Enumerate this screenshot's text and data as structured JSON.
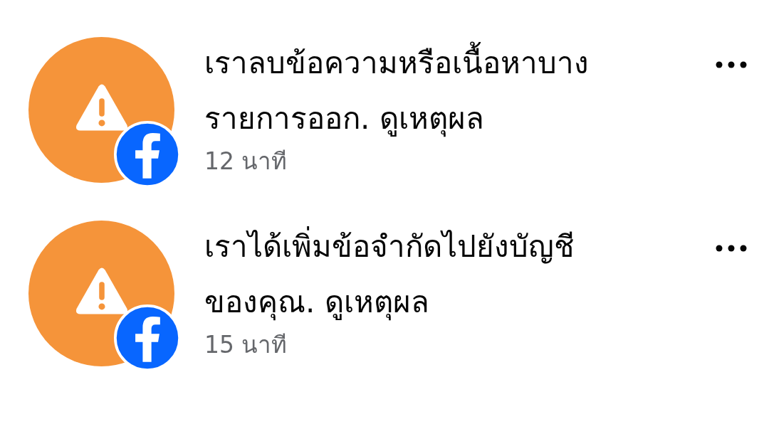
{
  "notifications": [
    {
      "message_lines": [
        "เราลบข้อความหรือเนื้อหาบาง",
        "รายการออก. ดูเหตุผล"
      ],
      "time": "12 นาที"
    },
    {
      "message_lines": [
        "เราได้เพิ่มข้อจำกัดไปยังบัญชี",
        "ของคุณ. ดูเหตุผล"
      ],
      "time": "15 นาที"
    }
  ]
}
